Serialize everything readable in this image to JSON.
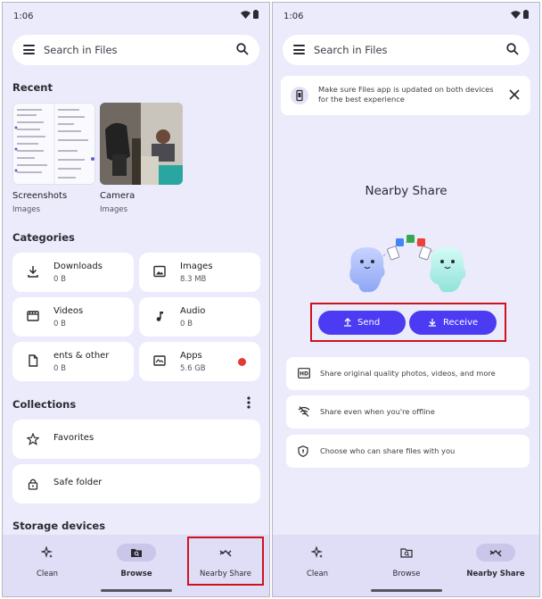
{
  "status": {
    "time": "1:06"
  },
  "search": {
    "placeholder": "Search in Files"
  },
  "left": {
    "recent": {
      "title": "Recent",
      "items": [
        {
          "name": "Screenshots",
          "sub": "Images"
        },
        {
          "name": "Camera",
          "sub": "Images"
        }
      ]
    },
    "categories": {
      "title": "Categories",
      "items": [
        {
          "name": "Downloads",
          "size": "0 B",
          "icon": "download-icon"
        },
        {
          "name": "Images",
          "size": "8.3 MB",
          "icon": "image-icon"
        },
        {
          "name": "Videos",
          "size": "0 B",
          "icon": "video-icon"
        },
        {
          "name": "Audio",
          "size": "0 B",
          "icon": "music-note-icon"
        },
        {
          "name": "ents & other",
          "size": "0 B",
          "icon": "document-icon"
        },
        {
          "name": "Apps",
          "size": "5.6 GB",
          "icon": "apps-icon"
        }
      ]
    },
    "collections": {
      "title": "Collections",
      "items": [
        {
          "name": "Favorites",
          "icon": "star-icon"
        },
        {
          "name": "Safe folder",
          "icon": "lock-icon"
        }
      ]
    },
    "storage": {
      "title": "Storage devices"
    }
  },
  "right": {
    "banner": {
      "text": "Make sure Files app is updated on both devices for the best experience"
    },
    "nearby": {
      "title": "Nearby Share",
      "send": "Send",
      "receive": "Receive",
      "features": [
        {
          "text": "Share original quality photos, videos, and more",
          "icon": "hd-icon"
        },
        {
          "text": "Share even when you're offline",
          "icon": "wifi-off-icon"
        },
        {
          "text": "Choose who can share files with you",
          "icon": "shield-icon"
        }
      ]
    }
  },
  "nav": {
    "clean": "Clean",
    "browse": "Browse",
    "nearby": "Nearby Share"
  },
  "colors": {
    "accent": "#4b3bf3",
    "background": "#ecebfb",
    "highlight": "#d0121b",
    "badge": "#e53935"
  }
}
